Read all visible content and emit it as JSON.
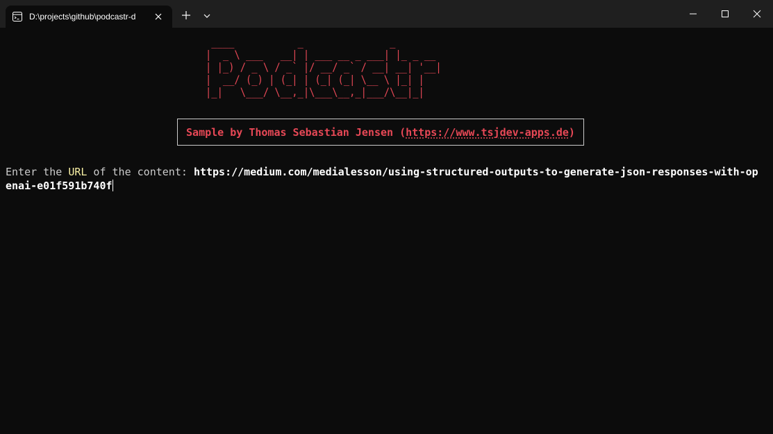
{
  "window": {
    "tab_title": "D:\\projects\\github\\podcastr-d"
  },
  "icons": {
    "tab": "terminal-icon",
    "close": "close-icon",
    "new_tab": "plus-icon",
    "dropdown": "chevron-down-icon",
    "minimize": "minimize-icon",
    "maximize": "maximize-icon",
    "window_close": "close-icon"
  },
  "terminal": {
    "logo_ascii": " ____           _               _\n|  _ \\ ___   __| | ___ __ _ ___| |_ _ __\n| |_) / _ \\ / _` |/ __/ _` / __| __| '__|\n|  __/ (_) | (_| | (_| (_| \\__ \\ |_| |\n|_|   \\___/ \\__,_|\\___\\__,_|___/\\__|_|",
    "banner": {
      "prefix": "Sample by Thomas Sebastian Jensen (",
      "link": "https://www.tsjdev-apps.de",
      "suffix": ")"
    },
    "prompt": {
      "before": "Enter the ",
      "highlight": "URL",
      "after": " of the content: ",
      "line1": "https://medium.com/medialesson/using-structured-outputs-to-generate-json-responses-with-op",
      "line2": "enai-e01f591b740f"
    }
  },
  "colors": {
    "background": "#0c0c0c",
    "titlebar": "#1f1f1f",
    "accent_red": "#e74856",
    "highlight_yellow": "#f9f1a5",
    "text": "#cccccc"
  }
}
